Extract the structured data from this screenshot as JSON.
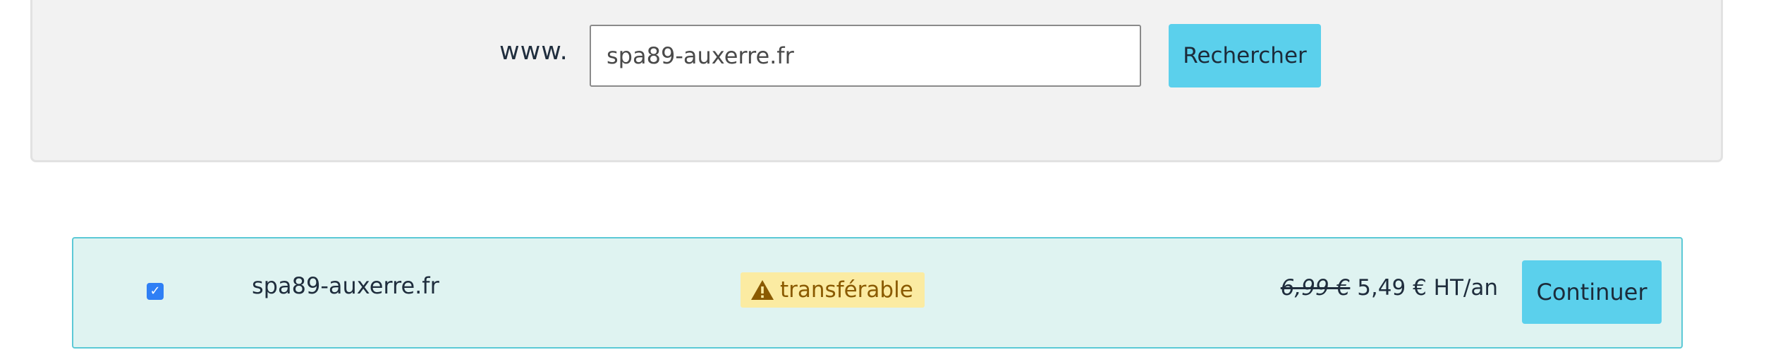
{
  "search": {
    "prefix": "www.",
    "value": "spa89-auxerre.fr",
    "button_label": "Rechercher"
  },
  "result": {
    "checked": true,
    "domain": "spa89-auxerre.fr",
    "status_icon": "warning-icon",
    "status": "transférable",
    "old_price": "6,99 €",
    "price": "5,49 € HT/an",
    "button_label": "Continuer"
  },
  "colors": {
    "accent_button": "#5bd0ec",
    "row_background": "#dff3f1",
    "row_border": "#5cc9d6",
    "badge_background": "#fbeba2",
    "badge_text": "#8a5a00",
    "checkbox": "#2f7ff5"
  }
}
